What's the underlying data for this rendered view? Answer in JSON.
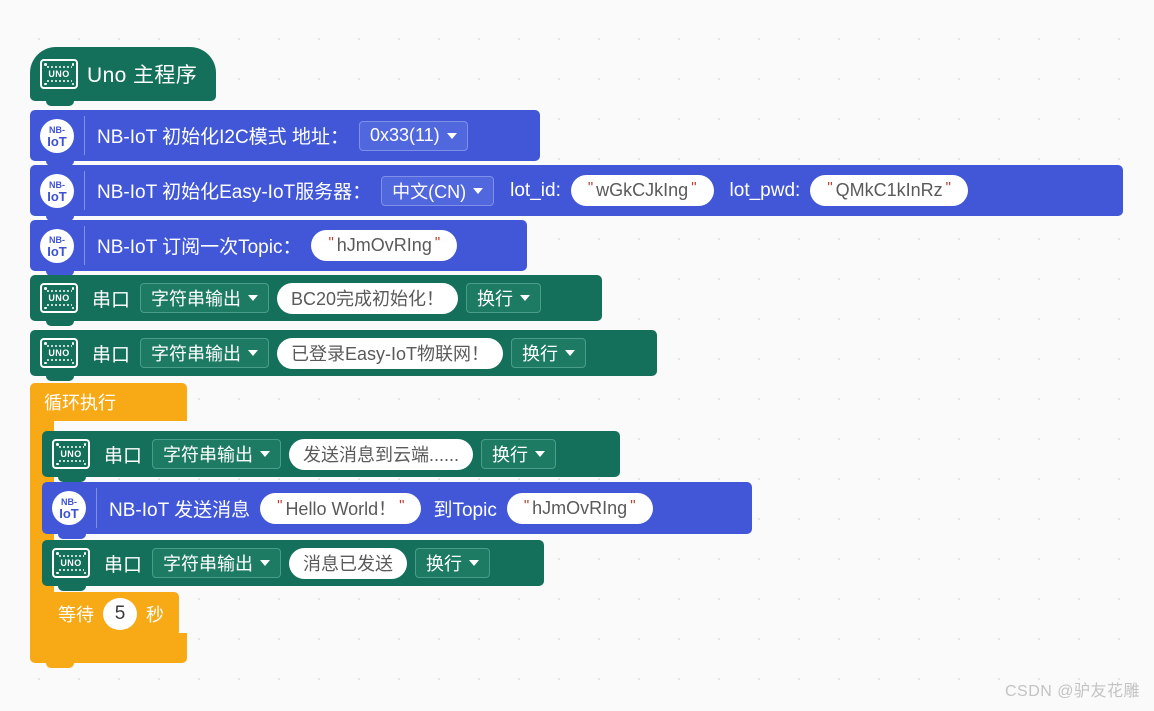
{
  "workspace": {
    "background_color": "#fafafa",
    "grid": true
  },
  "watermark": "CSDN @驴友花雕",
  "blocks": {
    "hat": {
      "icon": "uno-board-icon",
      "label": "Uno 主程序",
      "color": "#14705a"
    },
    "nb_init_i2c": {
      "icon": "nb-iot-icon",
      "label": "NB-IoT 初始化I2C模式 地址：",
      "dropdown_value": "0x33(11)",
      "color": "#4157d8"
    },
    "nb_init_server": {
      "icon": "nb-iot-icon",
      "label": "NB-IoT 初始化Easy-IoT服务器：",
      "dropdown_value": "中文(CN)",
      "lot_id_label": "lot_id:",
      "lot_id_value": "wGkCJkIng",
      "lot_pwd_label": "lot_pwd:",
      "lot_pwd_value": "QMkC1kInRz",
      "color": "#4157d8"
    },
    "nb_subscribe": {
      "icon": "nb-iot-icon",
      "label": "NB-IoT 订阅一次Topic：",
      "topic_value": "hJmOvRIng",
      "color": "#4157d8"
    },
    "serial_1": {
      "icon": "uno-board-icon",
      "label": "串口",
      "mode": "字符串输出",
      "text_value": "BC20完成初始化！",
      "newline": "换行",
      "color": "#14705a"
    },
    "serial_2": {
      "icon": "uno-board-icon",
      "label": "串口",
      "mode": "字符串输出",
      "text_value": "已登录Easy-IoT物联网！",
      "newline": "换行",
      "color": "#14705a"
    },
    "loop": {
      "label": "循环执行",
      "color": "#f7a916"
    },
    "serial_3": {
      "icon": "uno-board-icon",
      "label": "串口",
      "mode": "字符串输出",
      "text_value": "发送消息到云端......",
      "newline": "换行",
      "color": "#14705a"
    },
    "nb_send": {
      "icon": "nb-iot-icon",
      "label": "NB-IoT 发送消息",
      "message_value": "Hello World！",
      "to_topic_label": "到Topic",
      "topic_value": "hJmOvRIng",
      "color": "#4157d8"
    },
    "serial_4": {
      "icon": "uno-board-icon",
      "label": "串口",
      "mode": "字符串输出",
      "text_value": "消息已发送",
      "newline": "换行",
      "color": "#14705a"
    },
    "wait": {
      "prefix": "等待",
      "value": "5",
      "suffix": "秒",
      "color": "#f7a916"
    }
  }
}
